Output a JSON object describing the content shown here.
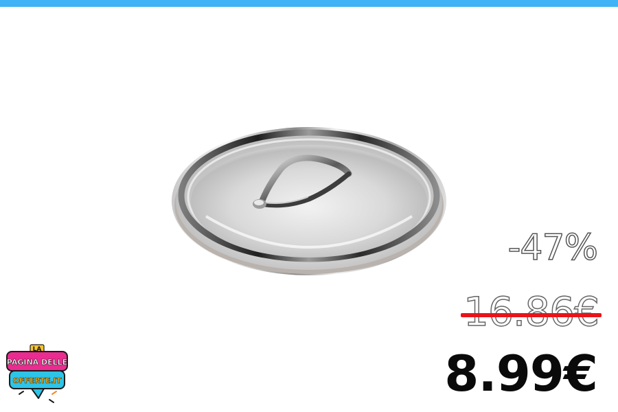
{
  "colors": {
    "top_bar": "#3fb3f5",
    "strike": "#e8141a",
    "logo_pink": "#ea2b8f",
    "logo_cyan": "#2ec4e8",
    "logo_yellow": "#f6c431",
    "logo_orange": "#f08a24"
  },
  "product": {
    "image_icon": "stainless-steel-pan-lid-icon"
  },
  "pricing": {
    "discount": "-47%",
    "old_price": "16.86€",
    "new_price": "8.99€"
  },
  "logo": {
    "line1": "LA",
    "line2": "PAGINA DELLE",
    "line3": "OFFERTE.IT"
  }
}
